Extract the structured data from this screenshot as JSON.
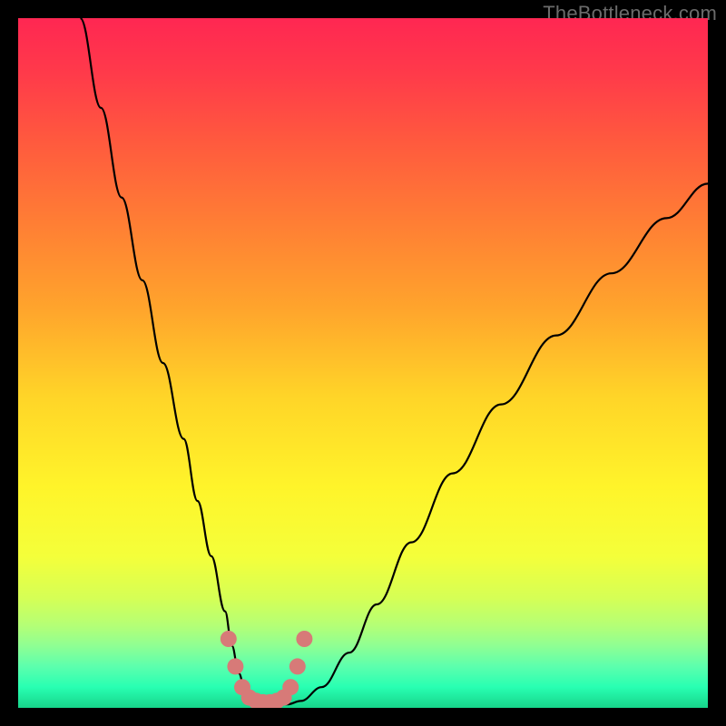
{
  "attribution": "TheBottleneck.com",
  "colors": {
    "black": "#000000",
    "curve_stroke": "#000000",
    "marker": "#d77a78",
    "text": "#6b6b6b"
  },
  "gradient_stops": [
    {
      "offset": 0.0,
      "color": "#ff2752"
    },
    {
      "offset": 0.08,
      "color": "#ff3a4a"
    },
    {
      "offset": 0.18,
      "color": "#ff5a3e"
    },
    {
      "offset": 0.3,
      "color": "#ff7f34"
    },
    {
      "offset": 0.42,
      "color": "#ffa42c"
    },
    {
      "offset": 0.55,
      "color": "#ffd528"
    },
    {
      "offset": 0.68,
      "color": "#fff42a"
    },
    {
      "offset": 0.78,
      "color": "#f4ff3a"
    },
    {
      "offset": 0.84,
      "color": "#d6ff55"
    },
    {
      "offset": 0.88,
      "color": "#b5ff75"
    },
    {
      "offset": 0.91,
      "color": "#8fff93"
    },
    {
      "offset": 0.94,
      "color": "#5cffad"
    },
    {
      "offset": 0.97,
      "color": "#28ffb2"
    },
    {
      "offset": 1.0,
      "color": "#17d48a"
    }
  ],
  "chart_data": {
    "type": "line",
    "title": "",
    "xlabel": "",
    "ylabel": "",
    "xlim": [
      0,
      100
    ],
    "ylim": [
      0,
      100
    ],
    "series": [
      {
        "name": "bottleneck-curve",
        "x": [
          9,
          12,
          15,
          18,
          21,
          24,
          26,
          28,
          30,
          31,
          32,
          33,
          35,
          37,
          39,
          41,
          44,
          48,
          52,
          57,
          63,
          70,
          78,
          86,
          94,
          100
        ],
        "values": [
          100,
          87,
          74,
          62,
          50,
          39,
          30,
          22,
          14,
          9,
          5,
          2,
          1,
          0.5,
          0.5,
          1,
          3,
          8,
          15,
          24,
          34,
          44,
          54,
          63,
          71,
          76
        ]
      }
    ],
    "markers": {
      "name": "highlight-band",
      "x": [
        30.5,
        31.5,
        32.5,
        33.5,
        34.5,
        35.5,
        36.5,
        37.5,
        38.5,
        39.5,
        40.5,
        41.5
      ],
      "values": [
        10,
        6,
        3,
        1.5,
        1,
        0.8,
        0.8,
        1,
        1.5,
        3,
        6,
        10
      ]
    }
  }
}
